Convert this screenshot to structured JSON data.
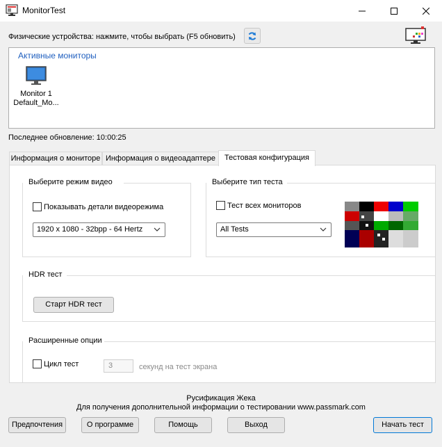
{
  "window": {
    "title": "MonitorTest"
  },
  "header": {
    "physical_devices_label": "Физические устройства: нажмите, чтобы выбрать (F5 обновить)"
  },
  "monitors": {
    "legend": "Активные мониторы",
    "items": [
      {
        "name": "Monitor 1",
        "sub": "Default_Mo..."
      }
    ]
  },
  "last_update": "Последнее обновление: 10:00:25",
  "tabs": [
    {
      "label": "Информация о мониторе",
      "active": false
    },
    {
      "label": "Информация о видеоадаптере",
      "active": false
    },
    {
      "label": "Тестовая конфигурация",
      "active": true
    }
  ],
  "video_mode": {
    "title": "Выберите режим видео",
    "details_checkbox": "Показывать детали видеорежима",
    "details_checked": false,
    "selected": "1920 x 1080 - 32bpp - 64 Hertz"
  },
  "test_type": {
    "title": "Выберите тип теста",
    "all_monitors_checkbox": "Тест всех мониторов",
    "all_monitors_checked": false,
    "selected": "All Tests"
  },
  "hdr": {
    "title": "HDR тест",
    "button": "Старт HDR тест"
  },
  "advanced": {
    "title": "Расширенные опции",
    "loop_checkbox": "Цикл тест",
    "loop_checked": false,
    "seconds_value": "3",
    "seconds_label": "секунд на тест экрана"
  },
  "footer": {
    "credit": "Русификация Жека",
    "info": "Для получения дополнительной информации о тестировании www.passmark.com"
  },
  "buttons": {
    "preferences": "Предпочтения",
    "about": "О программе",
    "help": "Помощь",
    "exit": "Выход",
    "start": "Начать тест"
  },
  "colors": {
    "accent": "#0078d7",
    "legend_blue": "#1f5fbf"
  }
}
